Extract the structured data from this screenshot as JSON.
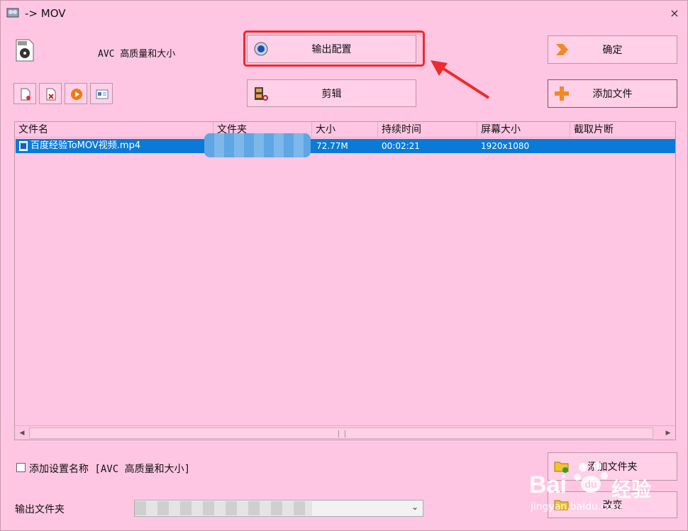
{
  "window": {
    "title": "-> MOV",
    "close": "×"
  },
  "profile": {
    "label": "AVC 高质量和大小"
  },
  "buttons": {
    "output_config": "输出配置",
    "clip": "剪辑",
    "ok": "确定",
    "add_file": "添加文件",
    "add_folder": "添加文件夹",
    "change": "改变"
  },
  "columns": [
    "文件名",
    "文件夹",
    "大小",
    "持续时间",
    "屏幕大小",
    "截取片断"
  ],
  "rows": [
    {
      "name": "百度经验ToMOV视频.mp4",
      "folder": "",
      "size": "72.77M",
      "duration": "00:02:21",
      "resolution": "1920x1080",
      "clip": ""
    }
  ],
  "options": {
    "add_setting_name": "添加设置名称 [AVC 高质量和大小]"
  },
  "output": {
    "label": "输出文件夹"
  },
  "watermark": {
    "brand": "Bai",
    "brand_cn": "经验",
    "url": "jingyan.baidu.com"
  },
  "colors": {
    "background": "#ffc6e3",
    "selection": "#0a7ad6",
    "highlight_border": "#ee2a2a"
  }
}
